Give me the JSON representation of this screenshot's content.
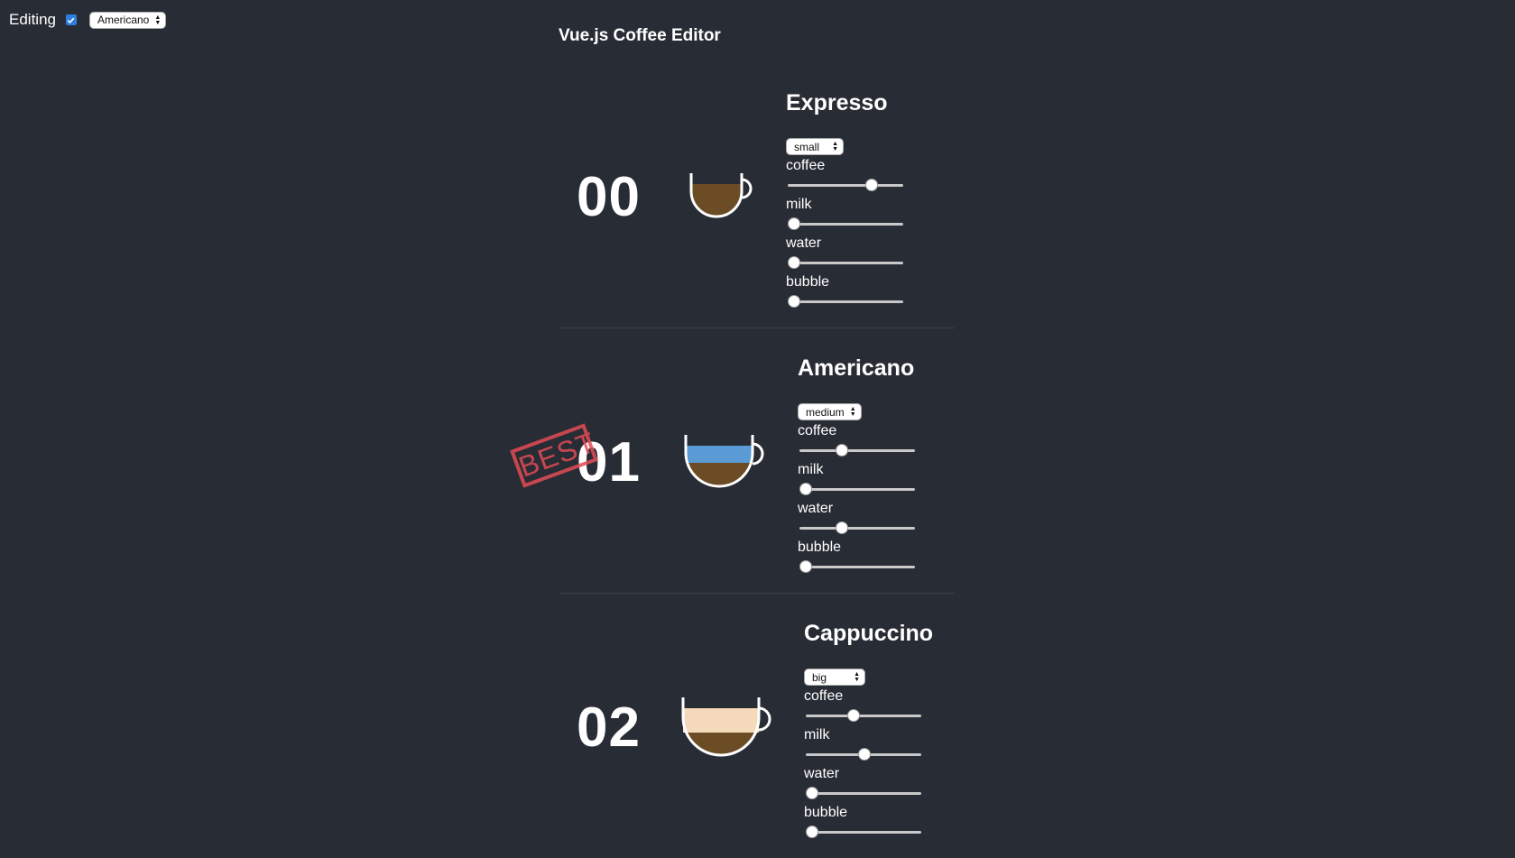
{
  "topbar": {
    "editing_label": "Editing",
    "editing_checked": true,
    "selected_coffee": "Americano"
  },
  "page": {
    "title": "Vue.js Coffee Editor"
  },
  "colors": {
    "background": "#282c35",
    "coffee": "#6b4c24",
    "water": "#5a9bd5",
    "milk": "#f5d9bb",
    "stamp": "#e34c55",
    "checkbox": "#2f7fe0"
  },
  "stamp": {
    "text": "BEST"
  },
  "coffees": [
    {
      "index": "00",
      "name": "Expresso",
      "size": "small",
      "params": [
        {
          "label": "coffee",
          "value": 0.75
        },
        {
          "label": "milk",
          "value": 0
        },
        {
          "label": "water",
          "value": 0
        },
        {
          "label": "bubble",
          "value": 0
        }
      ]
    },
    {
      "index": "01",
      "name": "Americano",
      "size": "medium",
      "params": [
        {
          "label": "coffee",
          "value": 0.35
        },
        {
          "label": "milk",
          "value": 0
        },
        {
          "label": "water",
          "value": 0.35
        },
        {
          "label": "bubble",
          "value": 0
        }
      ]
    },
    {
      "index": "02",
      "name": "Cappuccino",
      "size": "big",
      "params": [
        {
          "label": "coffee",
          "value": 0.4
        },
        {
          "label": "milk",
          "value": 0.5
        },
        {
          "label": "water",
          "value": 0
        },
        {
          "label": "bubble",
          "value": 0
        }
      ]
    }
  ]
}
